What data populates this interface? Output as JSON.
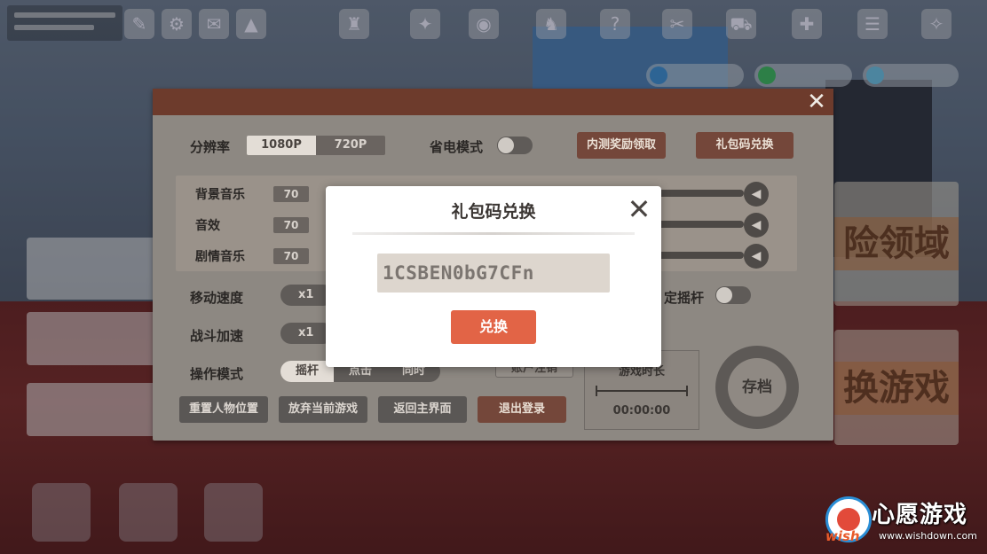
{
  "settings": {
    "resolution_label": "分辨率",
    "resolution_options": [
      "1080P",
      "720P"
    ],
    "power_saving_label": "省电模式",
    "beta_reward_button": "内测奖励领取",
    "gift_code_button": "礼包码兑换",
    "audio": [
      {
        "label": "背景音乐",
        "value": "70"
      },
      {
        "label": "音效",
        "value": "70"
      },
      {
        "label": "剧情音乐",
        "value": "70"
      }
    ],
    "move_speed_label": "移动速度",
    "move_speed_value": "x1",
    "fixed_joystick_label": "定摇杆",
    "battle_speed_label": "战斗加速",
    "battle_speed_value": "x1",
    "control_mode_label": "操作模式",
    "control_mode_options": [
      "摇杆",
      "点击",
      "同时"
    ],
    "account_logout_partial": "账户注销",
    "play_time_label": "游戏时长",
    "play_time_value": "00:00:00",
    "save_label": "存档",
    "buttons": {
      "reset_position": "重置人物位置",
      "abandon_game": "放弃当前游戏",
      "return_main": "返回主界面",
      "logout": "退出登录"
    }
  },
  "gift_modal": {
    "title": "礼包码兑换",
    "code_value": "1CSBEN0bG7CFn",
    "redeem_button": "兑换"
  },
  "background": {
    "right_banner_1": "险领域",
    "right_banner_2": "换游戏"
  },
  "watermark": {
    "brand": "心愿游戏",
    "wish": "wish",
    "url": "www.wishdown.com"
  },
  "colors": {
    "modal_button": "#e26446",
    "panel_bg": "#8d8882",
    "panel_titlebar": "#6d3b2c",
    "brown_button": "#74473a"
  }
}
